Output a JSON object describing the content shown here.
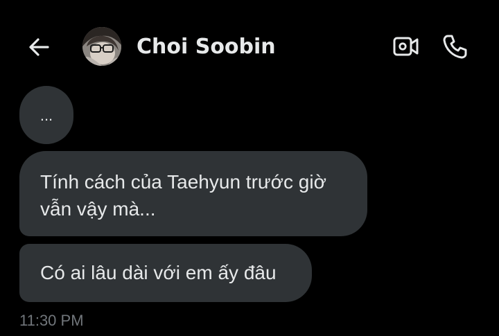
{
  "header": {
    "back_icon": "arrow-left-icon",
    "contact_name": "Choi Soobin",
    "avatar_icon": "contact-avatar",
    "video_call_icon": "video-call-icon",
    "voice_call_icon": "phone-icon"
  },
  "messages": [
    {
      "text": "..."
    },
    {
      "lines": [
        "Tính cách của Taehyun trước giờ",
        "vẫn vậy mà..."
      ]
    },
    {
      "text": "Có ai lâu dài với em ấy đâu"
    }
  ],
  "timestamp": "11:30 PM",
  "colors": {
    "background": "#000000",
    "bubble": "#2f3336",
    "text": "#e7e9ea",
    "muted": "#71767b"
  }
}
